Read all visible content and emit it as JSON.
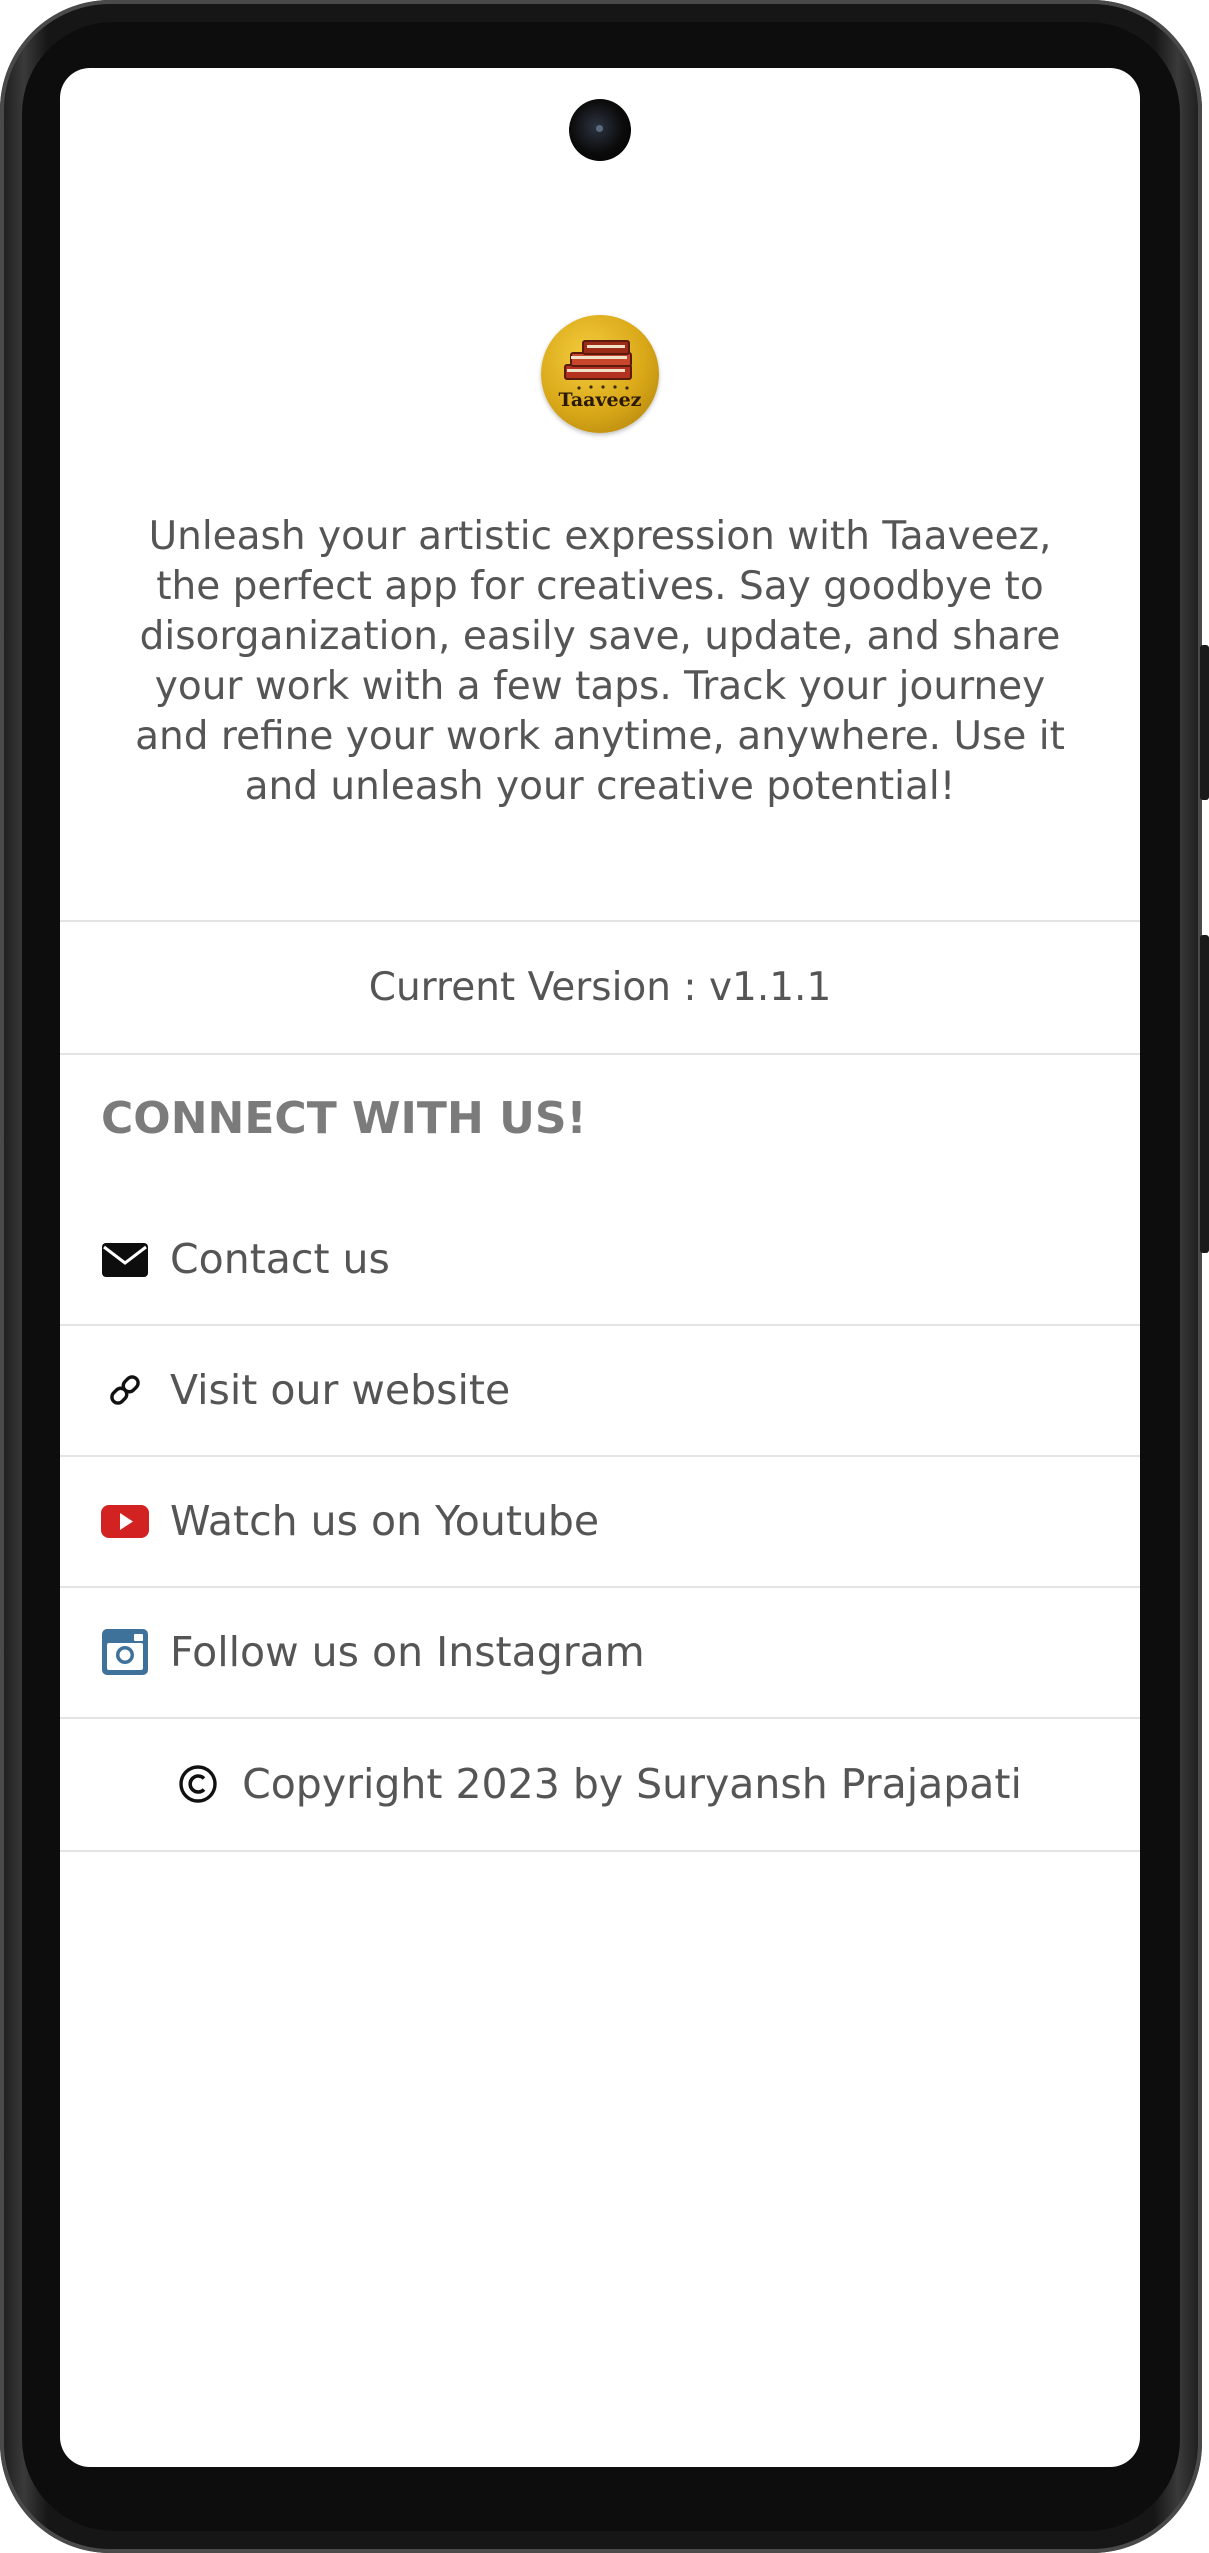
{
  "app": {
    "name": "Taaveez",
    "logo_text": "Taaveez"
  },
  "about": {
    "description": "Unleash your artistic expression with Taaveez, the perfect app for creatives. Say goodbye to disorganization, easily save, update, and share your work with a few taps. Track your journey and refine your work anytime, anywhere. Use it and unleash your creative potential!",
    "version_label": "Current Version : v1.1.1"
  },
  "connect": {
    "heading": "CONNECT WITH US!",
    "items": [
      {
        "label": "Contact us",
        "icon": "envelope-icon"
      },
      {
        "label": "Visit our website",
        "icon": "link-icon"
      },
      {
        "label": "Watch us on Youtube",
        "icon": "youtube-icon"
      },
      {
        "label": "Follow us on Instagram",
        "icon": "instagram-icon"
      }
    ]
  },
  "footer": {
    "copyright": "Copyright 2023 by Suryansh Prajapati",
    "icon": "copyright-icon"
  },
  "colors": {
    "text": "#555555",
    "heading": "#7b7b7b",
    "youtube": "#d32222",
    "instagram": "#3f729b",
    "divider": "#e4e4e4"
  }
}
